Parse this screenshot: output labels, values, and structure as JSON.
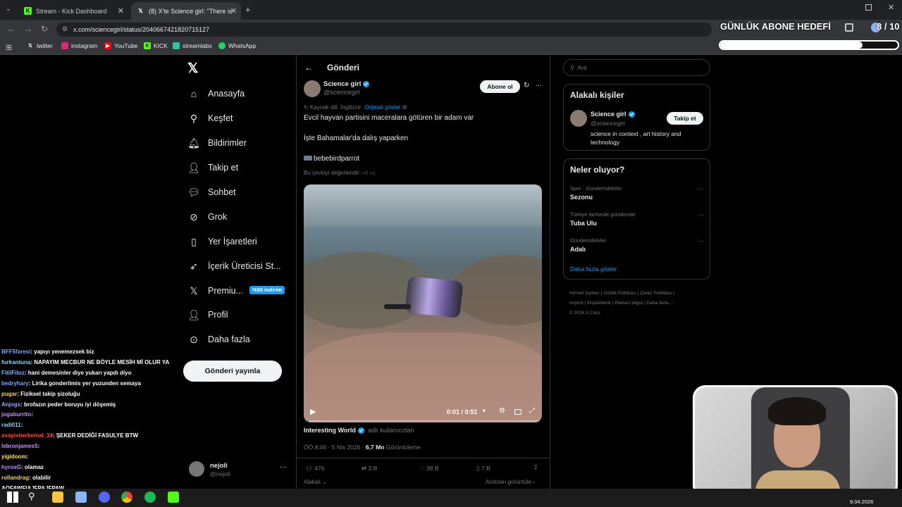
{
  "browser": {
    "tabs": [
      {
        "title": "Stream - Kick Dashboard",
        "icon": "kick-icon"
      },
      {
        "title": "(8) X'te Science girl: \"There is a",
        "icon": "x-icon"
      }
    ],
    "new_tab": "+",
    "url": "x.com/sciencegirl/status/2040667421820715127",
    "bookmarks": [
      {
        "label": "twitter",
        "icon": "x-icon"
      },
      {
        "label": "instagram",
        "icon": "instagram-icon"
      },
      {
        "label": "YouTube",
        "icon": "youtube-icon"
      },
      {
        "label": "KICK",
        "icon": "kick-icon"
      },
      {
        "label": "streamlabs",
        "icon": "streamlabs-icon"
      },
      {
        "label": "WhatsApp",
        "icon": "whatsapp-icon"
      }
    ]
  },
  "overlay": {
    "goal_title": "GÜNLÜK ABONE HEDEFİ",
    "goal_count": "8 / 10",
    "goal_progress": 0.8
  },
  "sidebar": {
    "items": [
      {
        "label": "Anasayfa",
        "icon": "home-icon"
      },
      {
        "label": "Keşfet",
        "icon": "search-icon"
      },
      {
        "label": "Bildirimler",
        "icon": "bell-icon"
      },
      {
        "label": "Takip et",
        "icon": "follow-icon"
      },
      {
        "label": "Sohbet",
        "icon": "chat-icon"
      },
      {
        "label": "Grok",
        "icon": "grok-icon"
      },
      {
        "label": "Yer İşaretleri",
        "icon": "bookmark-icon"
      },
      {
        "label": "İçerik Üreticisi St...",
        "icon": "rocket-icon"
      },
      {
        "label": "Premiu...",
        "icon": "x-icon"
      },
      {
        "label": "Profil",
        "icon": "person-icon"
      },
      {
        "label": "Daha fazla",
        "icon": "more-icon"
      }
    ],
    "premium_badge": "%50 indirim",
    "post_button": "Gönderi yayınla",
    "account": {
      "name": "nejoli",
      "handle": "@nejoli"
    }
  },
  "post": {
    "header": "Gönderi",
    "author_name": "Science girl",
    "author_handle": "@sciencegirl",
    "subscribe_button": "Abone ol",
    "source_lang": "Kaynak dili: İngilizce",
    "show_original": "Orijinali göster",
    "line1": "Evcil hayvan partisini maceralara götüren bir adam var",
    "line2": "İşte Bahamalar'da dalış yaparken",
    "line3": "bebebirdparrot",
    "rate_translation": "Bu çeviriyi değerlendir:",
    "video_time": "0:01 / 0:51",
    "video_progress": 0.02,
    "credit_name": "Interesting World",
    "credit_suffix": "adlı kullanıcıdan",
    "timestamp": "ÖÖ 8:46 · 5 Nis 2026 ·",
    "views": "6,7 Mn",
    "views_label": "Görüntüleme",
    "stats": {
      "replies": "476",
      "reposts": "3 B",
      "likes": "38 B",
      "bookmarks": "7 B"
    },
    "footer_left": "Alakalı",
    "footer_right": "Alıntıları görüntüle"
  },
  "right": {
    "search_placeholder": "Ara",
    "related_title": "Alakalı kişiler",
    "related": {
      "name": "Science girl",
      "handle": "@sciencegirl",
      "bio": "science in context , art history and technology",
      "follow": "Takip et"
    },
    "trends_title": "Neler oluyor?",
    "trends": [
      {
        "context": "Spor · Gündemdekiler",
        "topic": "Sezonu"
      },
      {
        "context": "Türkiye tarihinde gündemde",
        "topic": "Tuba Ulu"
      },
      {
        "context": "Gündemdekiler",
        "topic": "Adalı"
      }
    ],
    "show_more": "Daha fazla göster",
    "footer_links": [
      "Hizmet Şartları",
      "Gizlilik Politikası",
      "Çerez Politikası",
      "Imprint",
      "Erişilebilirlik",
      "Reklam bilgisi",
      "Daha fazla ..."
    ],
    "copyright": "© 2026 X Corp."
  },
  "chat": [
    {
      "user": "BFF5faresi",
      "msg": ": yapıyı yenemezsek biz",
      "color": "#7aa7ff"
    },
    {
      "user": "furkantuna",
      "msg": ": NAPAYIM MECBUR NE BÖYLE MESİH Mİ OLUR YA",
      "color": "#7fd3ff"
    },
    {
      "user": "FitilFitoz",
      "msg": ": hani demesinler diye yukarı yapdı diyo",
      "color": "#7fb2ff"
    },
    {
      "user": "bedryhary",
      "msg": ": Lirika gonderilmis yer yuzunden semaya",
      "color": "#7aa7ff"
    },
    {
      "user": "pugar",
      "msg": ": Fiziksel takip şizoluğu",
      "color": "#ffcf5a"
    },
    {
      "user": "Anjogs",
      "msg": ": brofazın peder boruyu iyi döşemiş",
      "color": "#9aa4ff"
    },
    {
      "user": "jogaburrito",
      "msg": ":",
      "color": "#c48cff"
    },
    {
      "user": "radi011",
      "msg": ":",
      "color": "#7fd3ff"
    },
    {
      "user": "asayisberkemal_34",
      "msg": ": ŞEKER DEDİĞİ FASULYE BTW",
      "color": "#ff4b4b"
    },
    {
      "user": "lebronjames5",
      "msg": ":",
      "color": "#c48cff"
    },
    {
      "user": "yigidoom",
      "msg": ":",
      "color": "#ffe066"
    },
    {
      "user": "hyroxG",
      "msg": ": olamaz",
      "color": "#c48cff"
    },
    {
      "user": "rollandrag",
      "msg": ": olabilir",
      "color": "#ffcf5a"
    },
    {
      "user": "AOFAWFIAJFPAJFPAW",
      "msg": "",
      "color": "#ffffff"
    }
  ],
  "taskbar": {
    "date": "9.04.2026"
  }
}
